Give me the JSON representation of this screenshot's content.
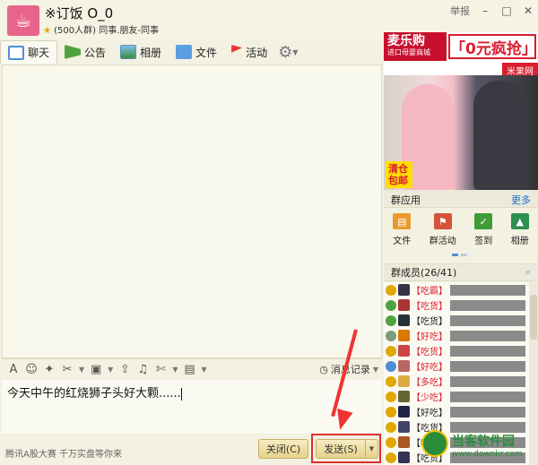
{
  "header": {
    "group_name": "※订饭 O_0",
    "group_size": "(500人群)",
    "group_tags": "同事.朋友-同事",
    "report_label": "举报",
    "minimize": "–",
    "maximize": "□",
    "close": "✕"
  },
  "tabs": [
    {
      "label": "聊天",
      "icon": "chat-icon"
    },
    {
      "label": "公告",
      "icon": "notice-flag-icon"
    },
    {
      "label": "相册",
      "icon": "album-icon"
    },
    {
      "label": "文件",
      "icon": "folder-icon"
    },
    {
      "label": "活动",
      "icon": "event-flag-icon"
    }
  ],
  "input_toolbar": {
    "history_label": "消息记录"
  },
  "input": {
    "text": "今天中午的红烧狮子头好大颗......"
  },
  "bottom": {
    "ad_text": "腾讯A股大赛 千万实盘等你来",
    "close_label": "关闭(C)",
    "send_label": "发送(S)"
  },
  "ad": {
    "brand": "麦乐购",
    "brand_sub": "进口母婴商城",
    "slogan": "「0元疯抢」",
    "tag": "米果网",
    "sale": "清仓包邮"
  },
  "apps": {
    "title": "群应用",
    "more": "更多",
    "items": [
      {
        "label": "文件",
        "icon": "file-icon"
      },
      {
        "label": "群活动",
        "icon": "group-event-icon"
      },
      {
        "label": "签到",
        "icon": "checkin-icon"
      },
      {
        "label": "相册",
        "icon": "photo-icon"
      }
    ]
  },
  "members": {
    "title": "群成员(26/41)",
    "list": [
      {
        "tag": "【吃霸】",
        "color": "red"
      },
      {
        "tag": "【吃货】",
        "color": "red"
      },
      {
        "tag": "【吃货】",
        "color": "black"
      },
      {
        "tag": "【好吃】",
        "color": "red"
      },
      {
        "tag": "【吃货】",
        "color": "red"
      },
      {
        "tag": "【好吃】",
        "color": "red"
      },
      {
        "tag": "【多吃】",
        "color": "red"
      },
      {
        "tag": "【少吃】",
        "color": "red"
      },
      {
        "tag": "【好吃】",
        "color": "black"
      },
      {
        "tag": "【吃货】",
        "color": "black"
      },
      {
        "tag": "【吃货】",
        "color": "black"
      },
      {
        "tag": "【吃货】",
        "color": "black"
      }
    ]
  },
  "watermark": {
    "cn": "当客软件园",
    "en": "www.downkr.com"
  }
}
